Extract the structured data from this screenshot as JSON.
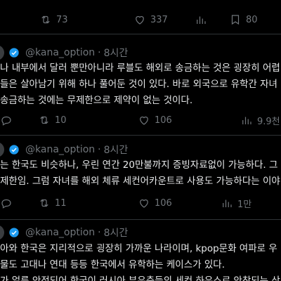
{
  "top_actions": {
    "retweets": "73",
    "likes": "337",
    "views": "",
    "bookmarks": "80"
  },
  "tweets": [
    {
      "handle": "@kana_option",
      "separator": "·",
      "time": "8시간",
      "lines": [
        "나 내부에서 달러 뿐만아니라 루블도 해외로 송금하는 것은 굉장히 어렵",
        "들은 살아남기 위해 하나 풀어둔 것이 있다. 바로 외국으로 유학간 자녀",
        "송금하는 것에는 무제한으로 제약이 없는 것이다."
      ],
      "actions": {
        "retweets": "",
        "replies": "10",
        "likes": "106",
        "views": "9.9천"
      }
    },
    {
      "handle": "@kana_option",
      "separator": "·",
      "time": "8시간",
      "lines": [
        "는 한국도 비슷하나, 우린 연간 20만불까지 증빙자료없이 가능하다. 그",
        "제한임. 그럼 자녀를 해외 체류 세컨어카운트로 사용도 가능하다는 이야"
      ],
      "actions": {
        "retweets": "",
        "replies": "11",
        "likes": "106",
        "views": "1만"
      }
    },
    {
      "handle": "@kana_option",
      "separator": "·",
      "time": "8시간",
      "lines": [
        "아와 한국은 지리적으로 굉장히 가까운 나라이며, kpop문화 여파로 우",
        "물도 고대나 연대 등등 한국에서 유학하는 케이스가 있다.",
        "가 얼른 안정되어 한국이 러시아 부유층들의 세컨 하우스로 안착되는 상"
      ]
    }
  ],
  "colors": {
    "background": "#000000",
    "text": "#e7e9ea",
    "muted": "#71767b",
    "divider": "#2f3336",
    "verified": "#1d9bf0"
  }
}
